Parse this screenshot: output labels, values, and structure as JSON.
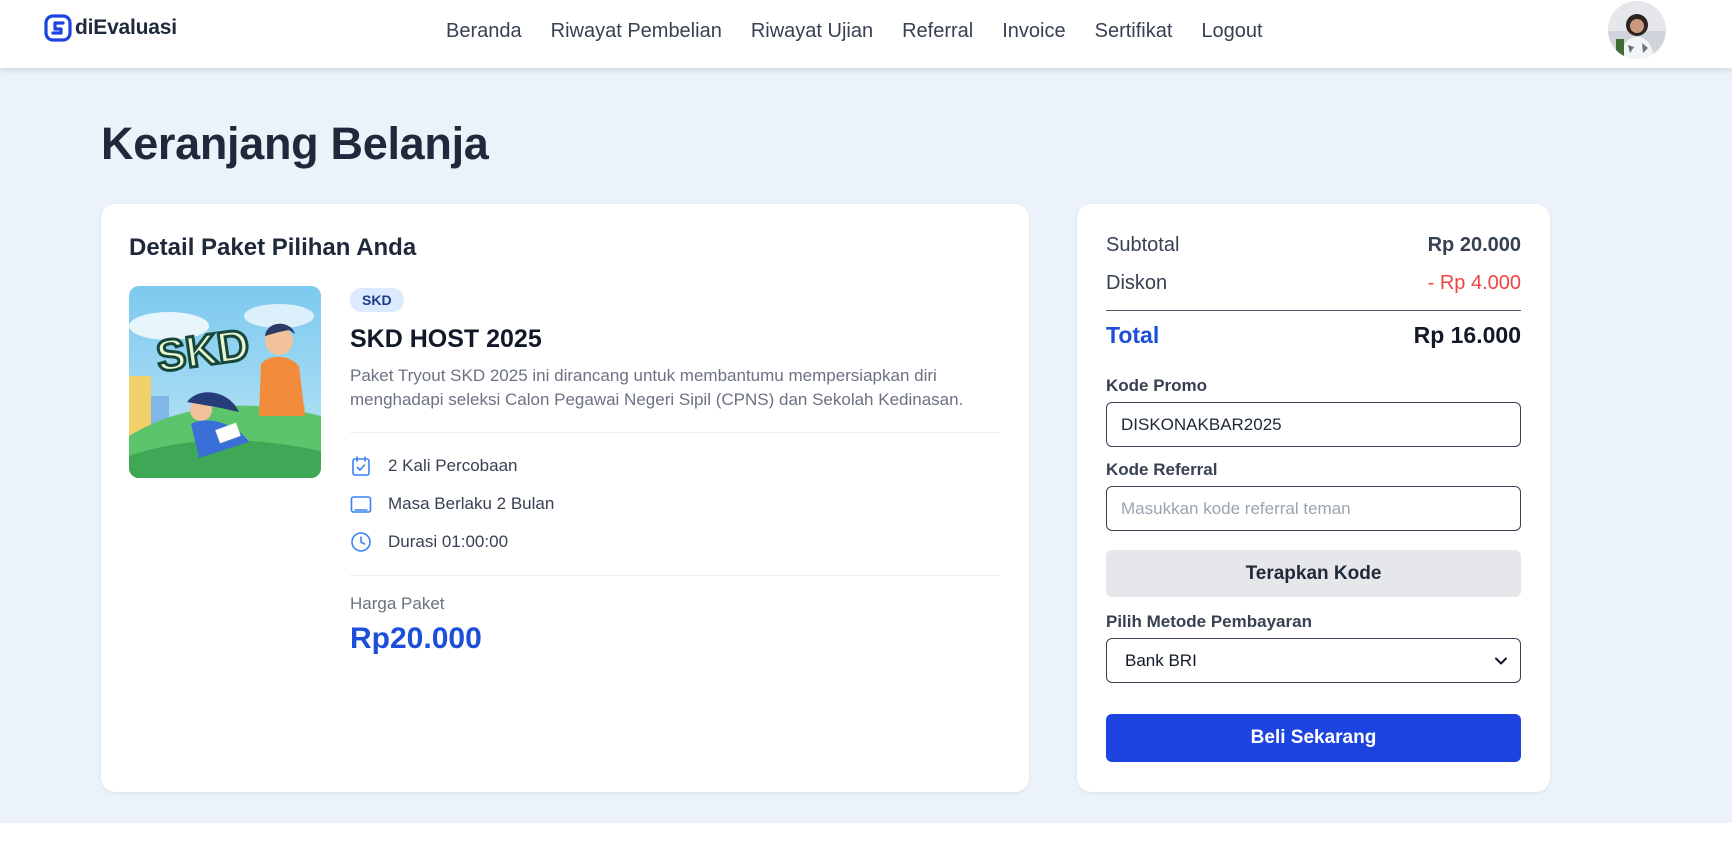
{
  "brand": {
    "name": "diEvaluasi",
    "accent": "#1d44e0"
  },
  "nav": {
    "items": [
      "Beranda",
      "Riwayat Pembelian",
      "Riwayat Ujian",
      "Referral",
      "Invoice",
      "Sertifikat",
      "Logout"
    ]
  },
  "page": {
    "title": "Keranjang Belanja"
  },
  "detail": {
    "heading": "Detail Paket Pilihan Anda",
    "package": {
      "tag": "SKD",
      "title": "SKD HOST 2025",
      "thumbnail_text": "SKD",
      "description": "Paket Tryout SKD 2025 ini dirancang untuk membantumu mempersiapkan diri menghadapi seleksi Calon Pegawai Negeri Sipil (CPNS) dan Sekolah Kedinasan. Paket...",
      "features": [
        {
          "icon": "calendar-check-icon",
          "label": "2 Kali Percobaan"
        },
        {
          "icon": "tablet-icon",
          "label": "Masa Berlaku 2 Bulan"
        },
        {
          "icon": "clock-icon",
          "label": "Durasi 01:00:00"
        }
      ],
      "price_label": "Harga Paket",
      "price": "Rp20.000"
    }
  },
  "summary": {
    "subtotal_label": "Subtotal",
    "subtotal_value": "Rp 20.000",
    "discount_label": "Diskon",
    "discount_value": "- Rp 4.000",
    "total_label": "Total",
    "total_value": "Rp 16.000",
    "promo_label": "Kode Promo",
    "promo_value": "DISKONAKBAR2025",
    "referral_label": "Kode Referral",
    "referral_placeholder": "Masukkan kode referral teman",
    "apply_button": "Terapkan Kode",
    "payment_label": "Pilih Metode Pembayaran",
    "payment_selected": "Bank BRI",
    "buy_button": "Beli Sekarang"
  }
}
